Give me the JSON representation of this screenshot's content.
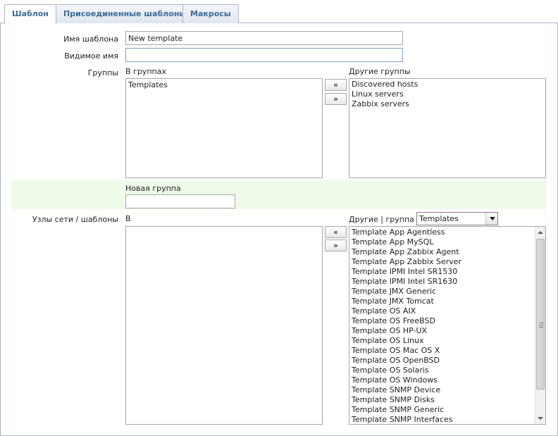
{
  "tabs": [
    {
      "label": "Шаблон",
      "active": true
    },
    {
      "label": "Присоединенные шаблоны",
      "active": false
    },
    {
      "label": "Макросы",
      "active": false
    }
  ],
  "form": {
    "template_name_label": "Имя шаблона",
    "template_name_value": "New template",
    "visible_name_label": "Видимое имя",
    "visible_name_value": "",
    "groups_label": "Группы",
    "in_groups_caption": "В группах",
    "in_groups": [
      "Templates"
    ],
    "other_groups_caption": "Другие группы",
    "other_groups": [
      "Discovered hosts",
      "Linux servers",
      "Zabbix servers"
    ],
    "move_left": "«",
    "move_right": "»",
    "new_group_label": "Новая группа",
    "new_group_value": "",
    "hosts_label": "Узлы сети / шаблоны",
    "in_caption": "В",
    "in_hosts": [],
    "other_caption": "Другие | группа",
    "group_select_value": "Templates",
    "other_hosts": [
      "Template App Agentless",
      "Template App MySQL",
      "Template App Zabbix Agent",
      "Template App Zabbix Server",
      "Template IPMI Intel SR1530",
      "Template IPMI Intel SR1630",
      "Template JMX Generic",
      "Template JMX Tomcat",
      "Template OS AIX",
      "Template OS FreeBSD",
      "Template OS HP-UX",
      "Template OS Linux",
      "Template OS Mac OS X",
      "Template OS OpenBSD",
      "Template OS Solaris",
      "Template OS Windows",
      "Template SNMP Device",
      "Template SNMP Disks",
      "Template SNMP Generic",
      "Template SNMP Interfaces"
    ]
  },
  "colors": {
    "tab_text": "#3b6a96",
    "border": "#aab4c0",
    "new_group_band": "#eefbe9"
  }
}
